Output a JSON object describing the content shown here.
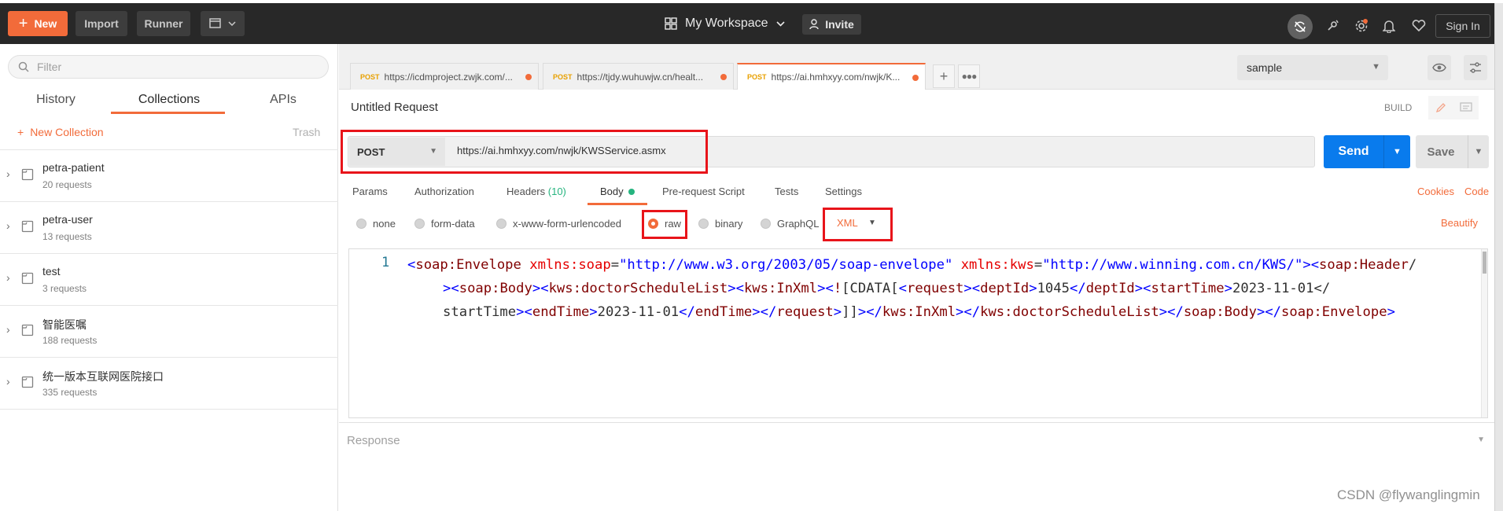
{
  "header": {
    "new_label": "New",
    "import_label": "Import",
    "runner_label": "Runner",
    "workspace_label": "My Workspace",
    "invite_label": "Invite",
    "signin_label": "Sign In"
  },
  "sidebar": {
    "filter_placeholder": "Filter",
    "tabs": [
      "History",
      "Collections",
      "APIs"
    ],
    "active_tab": "Collections",
    "new_collection_label": "New Collection",
    "trash_label": "Trash",
    "collections": [
      {
        "name": "petra-patient",
        "count": "20 requests"
      },
      {
        "name": "petra-user",
        "count": "13 requests"
      },
      {
        "name": "test",
        "count": "3 requests"
      },
      {
        "name": "智能医嘱",
        "count": "188 requests"
      },
      {
        "name": "统一版本互联网医院接口",
        "count": "335 requests"
      }
    ]
  },
  "tabs": [
    {
      "method": "POST",
      "url": "https://icdmproject.zwjk.com/..."
    },
    {
      "method": "POST",
      "url": "https://tjdy.wuhuwjw.cn/healt..."
    },
    {
      "method": "POST",
      "url": "https://ai.hmhxyy.com/nwjk/K..."
    }
  ],
  "environment": {
    "selected": "sample"
  },
  "request": {
    "title": "Untitled Request",
    "build_label": "BUILD",
    "method": "POST",
    "url": "https://ai.hmhxyy.com/nwjk/KWSService.asmx",
    "send_label": "Send",
    "save_label": "Save",
    "subtabs": {
      "params": "Params",
      "authorization": "Authorization",
      "headers": "Headers",
      "headers_count": "(10)",
      "body": "Body",
      "prerequest": "Pre-request Script",
      "tests": "Tests",
      "settings": "Settings"
    },
    "cookies_label": "Cookies",
    "code_label": "Code",
    "body_types": [
      "none",
      "form-data",
      "x-www-form-urlencoded",
      "raw",
      "binary",
      "GraphQL"
    ],
    "selected_body_type": "raw",
    "format": "XML",
    "beautify_label": "Beautify",
    "line_number": "1",
    "code_lines": [
      "<soap:Envelope xmlns:soap=\"http://www.w3.org/2003/05/soap-envelope\" xmlns:kws=\"http://www.winning.com.cn/KWS/\"><soap:Header/",
      "><soap:Body><kws:doctorScheduleList><kws:InXml><![CDATA[<request><deptId>1045</deptId><startTime>2023-11-01</",
      "startTime><endTime>2023-11-01</endTime></request>]]></kws:InXml></kws:doctorScheduleList></soap:Body></soap:Envelope>"
    ]
  },
  "response": {
    "label": "Response"
  },
  "watermark": "CSDN @flywanglingmin",
  "colors": {
    "accent": "#f26b3a",
    "send": "#097bed",
    "annotation": "#e8141a"
  }
}
